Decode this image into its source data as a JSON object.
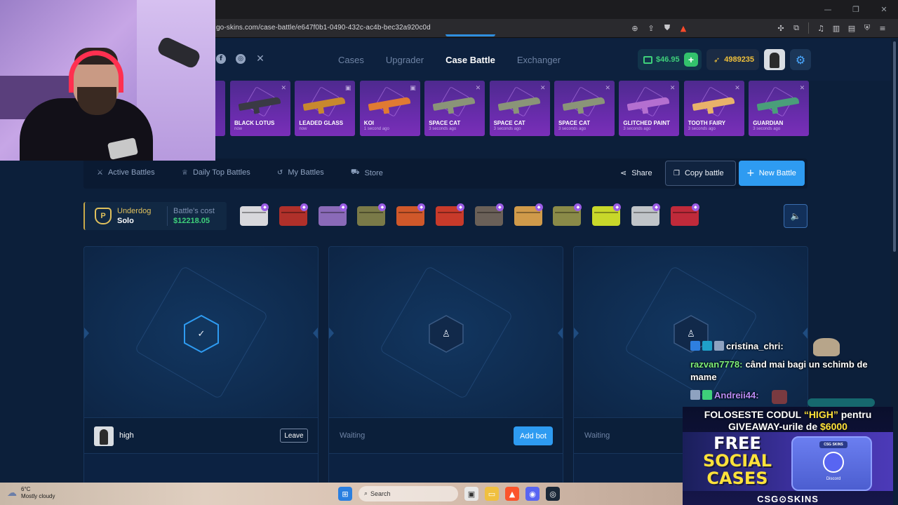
{
  "browser": {
    "url": "go-skins.com/case-battle/e647f0b1-0490-432c-ac4b-bec32a920c0d",
    "window_controls": [
      "—",
      "❐",
      "✕"
    ],
    "address_icons": [
      "zoom-icon",
      "share-icon",
      "brave-shields-icon",
      "brave-rewards-icon"
    ],
    "extension_icons": [
      "extensions-icon",
      "tab-icon",
      "music-icon",
      "sidebar-icon",
      "wallet-icon",
      "vpn-icon",
      "menu-icon"
    ]
  },
  "header": {
    "socials": [
      "facebook-icon",
      "instagram-icon",
      "x-icon"
    ],
    "nav": {
      "cases": "Cases",
      "upgrader": "Upgrader",
      "case_battle": "Case Battle",
      "exchanger": "Exchanger"
    },
    "balance": "$46.95",
    "coins": "4989235"
  },
  "drops": [
    {
      "name": "BLACK LOTUS",
      "time": "now",
      "icon": "✕",
      "gun_color": "#3a3a44"
    },
    {
      "name": "LEADED GLASS",
      "time": "now",
      "icon": "▣",
      "gun_color": "#c8882e"
    },
    {
      "name": "KOI",
      "time": "1 second ago",
      "icon": "▣",
      "gun_color": "#e07a32"
    },
    {
      "name": "SPACE CAT",
      "time": "3 seconds ago",
      "icon": "✕",
      "gun_color": "#8a9478"
    },
    {
      "name": "SPACE CAT",
      "time": "3 seconds ago",
      "icon": "✕",
      "gun_color": "#8a9478"
    },
    {
      "name": "SPACE CAT",
      "time": "3 seconds ago",
      "icon": "✕",
      "gun_color": "#8a9478"
    },
    {
      "name": "GLITCHED PAINT",
      "time": "3 seconds ago",
      "icon": "✕",
      "gun_color": "#b46fd0"
    },
    {
      "name": "TOOTH FAIRY",
      "time": "3 seconds ago",
      "icon": "✕",
      "gun_color": "#e8b26a"
    },
    {
      "name": "GUARDIAN",
      "time": "3 seconds ago",
      "icon": "✕",
      "gun_color": "#4a9e7a"
    }
  ],
  "subnav": {
    "active_battles": "Active Battles",
    "daily_top": "Daily Top Battles",
    "my_battles": "My Battles",
    "store": "Store",
    "share": "Share",
    "copy_battle": "Copy battle",
    "new_battle": "New Battle"
  },
  "battle": {
    "mode": "Underdog",
    "type": "Solo",
    "cost_label": "Battle's cost",
    "cost": "$12218.05",
    "cases": [
      {
        "color": "#d8d8dc"
      },
      {
        "color": "#b0302a"
      },
      {
        "color": "#8a6ab8"
      },
      {
        "color": "#7a7a48"
      },
      {
        "color": "#d0582a"
      },
      {
        "color": "#c83a2a"
      },
      {
        "color": "#6a6058"
      },
      {
        "color": "#d09a4a"
      },
      {
        "color": "#8a8a48"
      },
      {
        "color": "#c8d82a"
      },
      {
        "color": "#c0c4c8"
      },
      {
        "color": "#c02a3a"
      }
    ]
  },
  "slots": [
    {
      "state": "joined",
      "player": "high",
      "action": "Leave"
    },
    {
      "state": "waiting",
      "label": "Waiting",
      "action": "Add bot"
    },
    {
      "state": "waiting",
      "label": "Waiting"
    }
  ],
  "chat": [
    {
      "user": "cristina_chri:",
      "msg": "",
      "color": "#ffffff"
    },
    {
      "user": "razvan7778:",
      "msg": "când mai bagi un schimb de mame",
      "color": "#7ef07a"
    },
    {
      "user": "Andreii44:",
      "msg": "",
      "color": "#b98cf5"
    }
  ],
  "promo": {
    "line1_a": "FOLOSESTE CODUL",
    "code": "“HIGH”",
    "line1_b": "pentru",
    "line2_a": "GIVEAWAY-urile de",
    "amount": "$6000",
    "free": "FREE",
    "social": "SOCIAL",
    "cases": "CASES",
    "box_label": "CSG SKINS",
    "discord": "Discord",
    "brand": "CSG⊙SKINS"
  },
  "taskbar": {
    "temp": "6°C",
    "weather": "Mostly cloudy",
    "search": "Search"
  }
}
